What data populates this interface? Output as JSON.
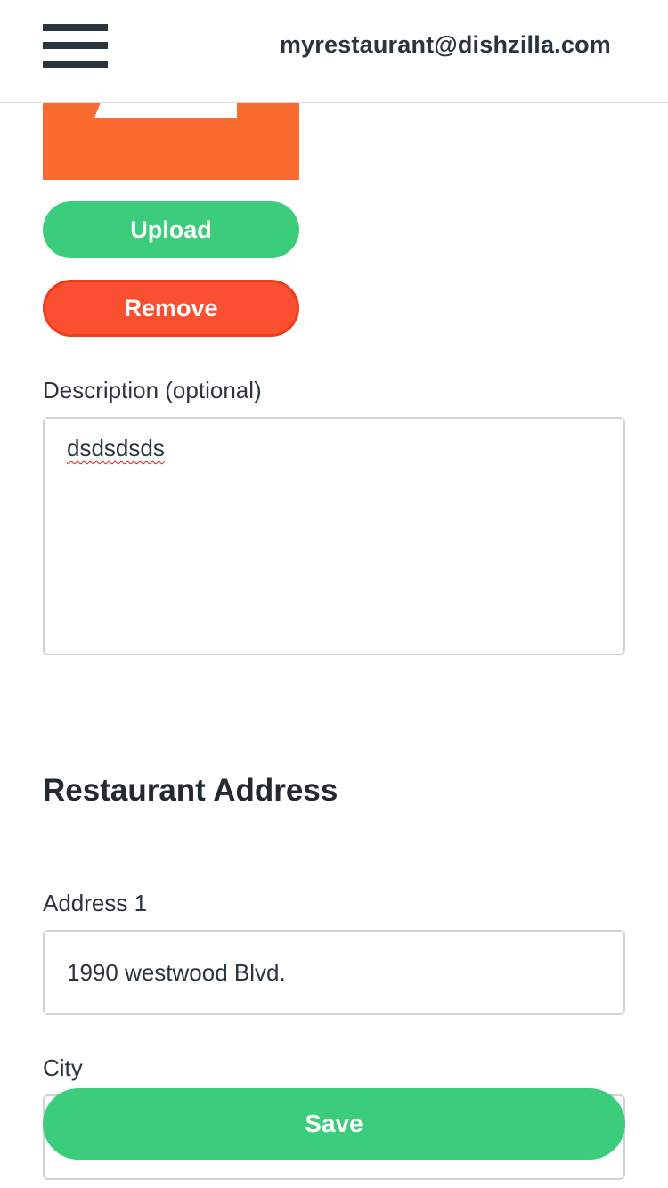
{
  "header": {
    "email": "myrestaurant@dishzilla.com",
    "menu_icon": "hamburger-menu-icon"
  },
  "logo": {
    "upload_label": "Upload",
    "remove_label": "Remove"
  },
  "description": {
    "label": "Description (optional)",
    "value": "dsdsdsds"
  },
  "address": {
    "section_title": "Restaurant Address",
    "address1_label": "Address 1",
    "address1_value": "1990 westwood Blvd.",
    "city_label": "City",
    "city_value": ""
  },
  "actions": {
    "save_label": "Save"
  },
  "colors": {
    "primary_green": "#3ccd7c",
    "danger_red": "#fb4f31",
    "logo_orange": "#fa6b2f"
  }
}
